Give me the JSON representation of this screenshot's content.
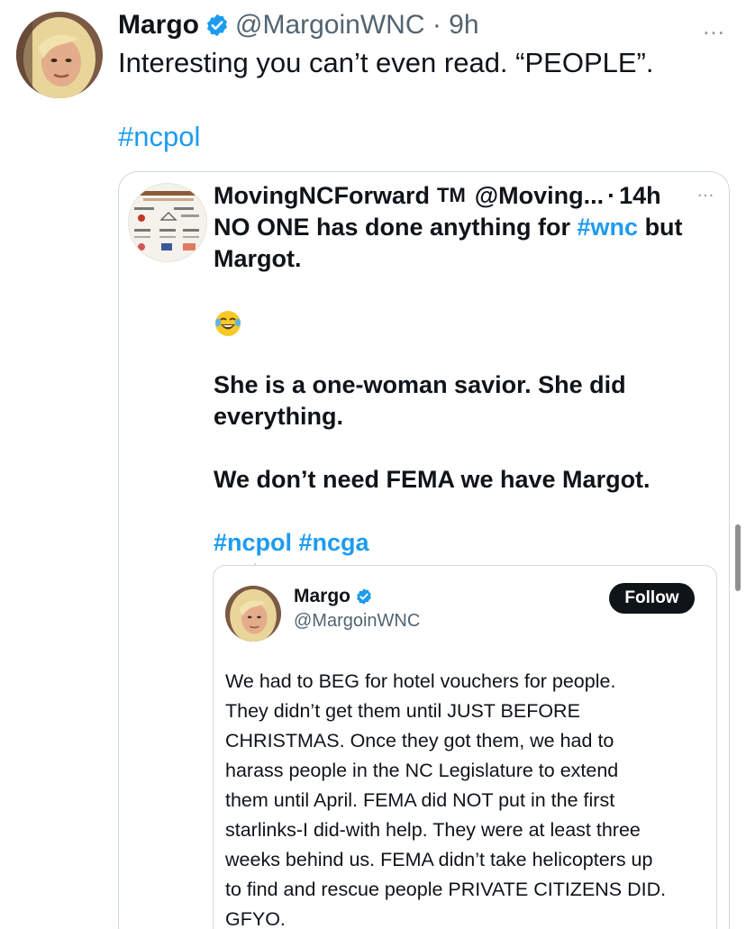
{
  "tweet": {
    "author_name": "Margo",
    "handle_meta": "@MargoinWNC · 9h",
    "more_icon": "…",
    "text": "Interesting you can’t even read. “PEOPLE”.",
    "hashtag": "#ncpol"
  },
  "quoted": {
    "author_name": "MovingNCForward",
    "tm": "TM",
    "handle": "@Moving...",
    "separator": "·",
    "time": "14h",
    "more_icon": "…",
    "line1_pre": "NO ONE has done anything for ",
    "line1_tag": "#wnc",
    "line1_post": " but",
    "line2": "Margot.",
    "line3": "She is a one-woman savior. She did",
    "line4": "everything.",
    "line5": "We don’t need FEMA  we have Margot.",
    "hashtag1": "#ncpol",
    "hashtag2": "#ncga",
    "emoji": "face-with-tears-of-joy"
  },
  "embedded": {
    "author_name": "Margo",
    "handle": "@MargoinWNC",
    "follow_label": "Follow",
    "lines": [
      "We had to BEG for hotel vouchers for people.",
      "They didn’t get them until JUST BEFORE",
      "CHRISTMAS. Once they got them, we had to",
      "harass people in the NC Legislature to extend",
      "them until April. FEMA did NOT put in the first",
      "starlinks-I did-with help. They were at least three",
      "weeks behind us. FEMA didn’t take helicopters up",
      "to find and rescue people PRIVATE CITIZENS DID.",
      "GFYO."
    ]
  },
  "colors": {
    "accent": "#1d9bf0",
    "text": "#0f1419",
    "muted": "#536471",
    "border": "#cfd9de"
  }
}
